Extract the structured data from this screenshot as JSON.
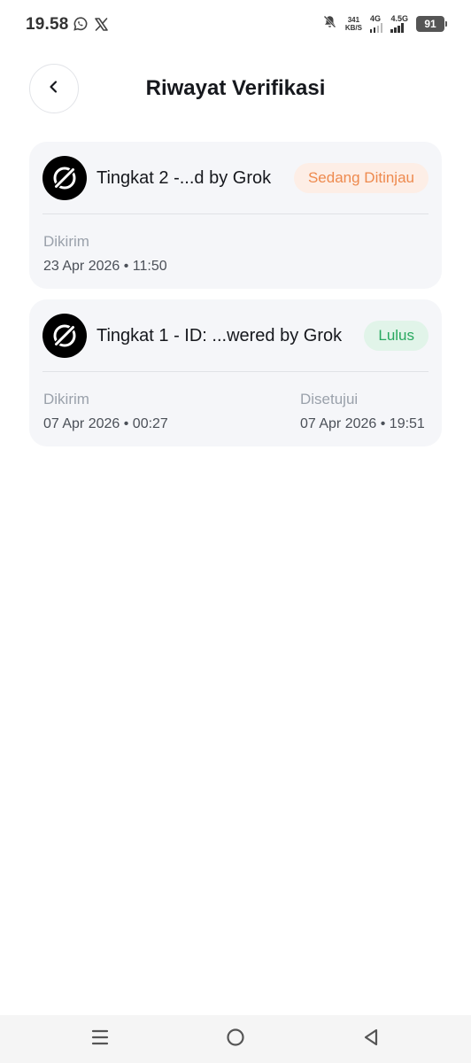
{
  "status_bar": {
    "time": "19.58",
    "speed_value": "341",
    "speed_unit": "KB/S",
    "net1_label": "4G",
    "net2_label": "4.5G",
    "battery_level": "91"
  },
  "header": {
    "title": "Riwayat Verifikasi"
  },
  "verifications": [
    {
      "title": "Tingkat 2 -...d by Grok",
      "status": "Sedang Ditinjau",
      "submitted_label": "Dikirim",
      "submitted_value": "23 Apr 2026 • 11:50"
    },
    {
      "title": "Tingkat 1 - ID: ...wered by Grok",
      "status": "Lulus",
      "submitted_label": "Dikirim",
      "submitted_value": "07 Apr 2026 • 00:27",
      "approved_label": "Disetujui",
      "approved_value": "07 Apr 2026 • 19:51"
    }
  ],
  "colors": {
    "pending_text": "#ee8a4e",
    "pending_bg": "#fdeee6",
    "approved_text": "#28a85f",
    "approved_bg": "#e1f4e9",
    "card_bg": "#f5f6f9"
  },
  "icons": {
    "status_left": [
      "whatsapp-icon",
      "x-icon"
    ],
    "status_right": [
      "notifications-muted-icon",
      "signal-icon",
      "battery-icon"
    ],
    "header": "back-chevron-icon",
    "card_logo": "grok-logo-icon",
    "nav": [
      "menu-icon",
      "home-icon",
      "back-icon"
    ]
  }
}
